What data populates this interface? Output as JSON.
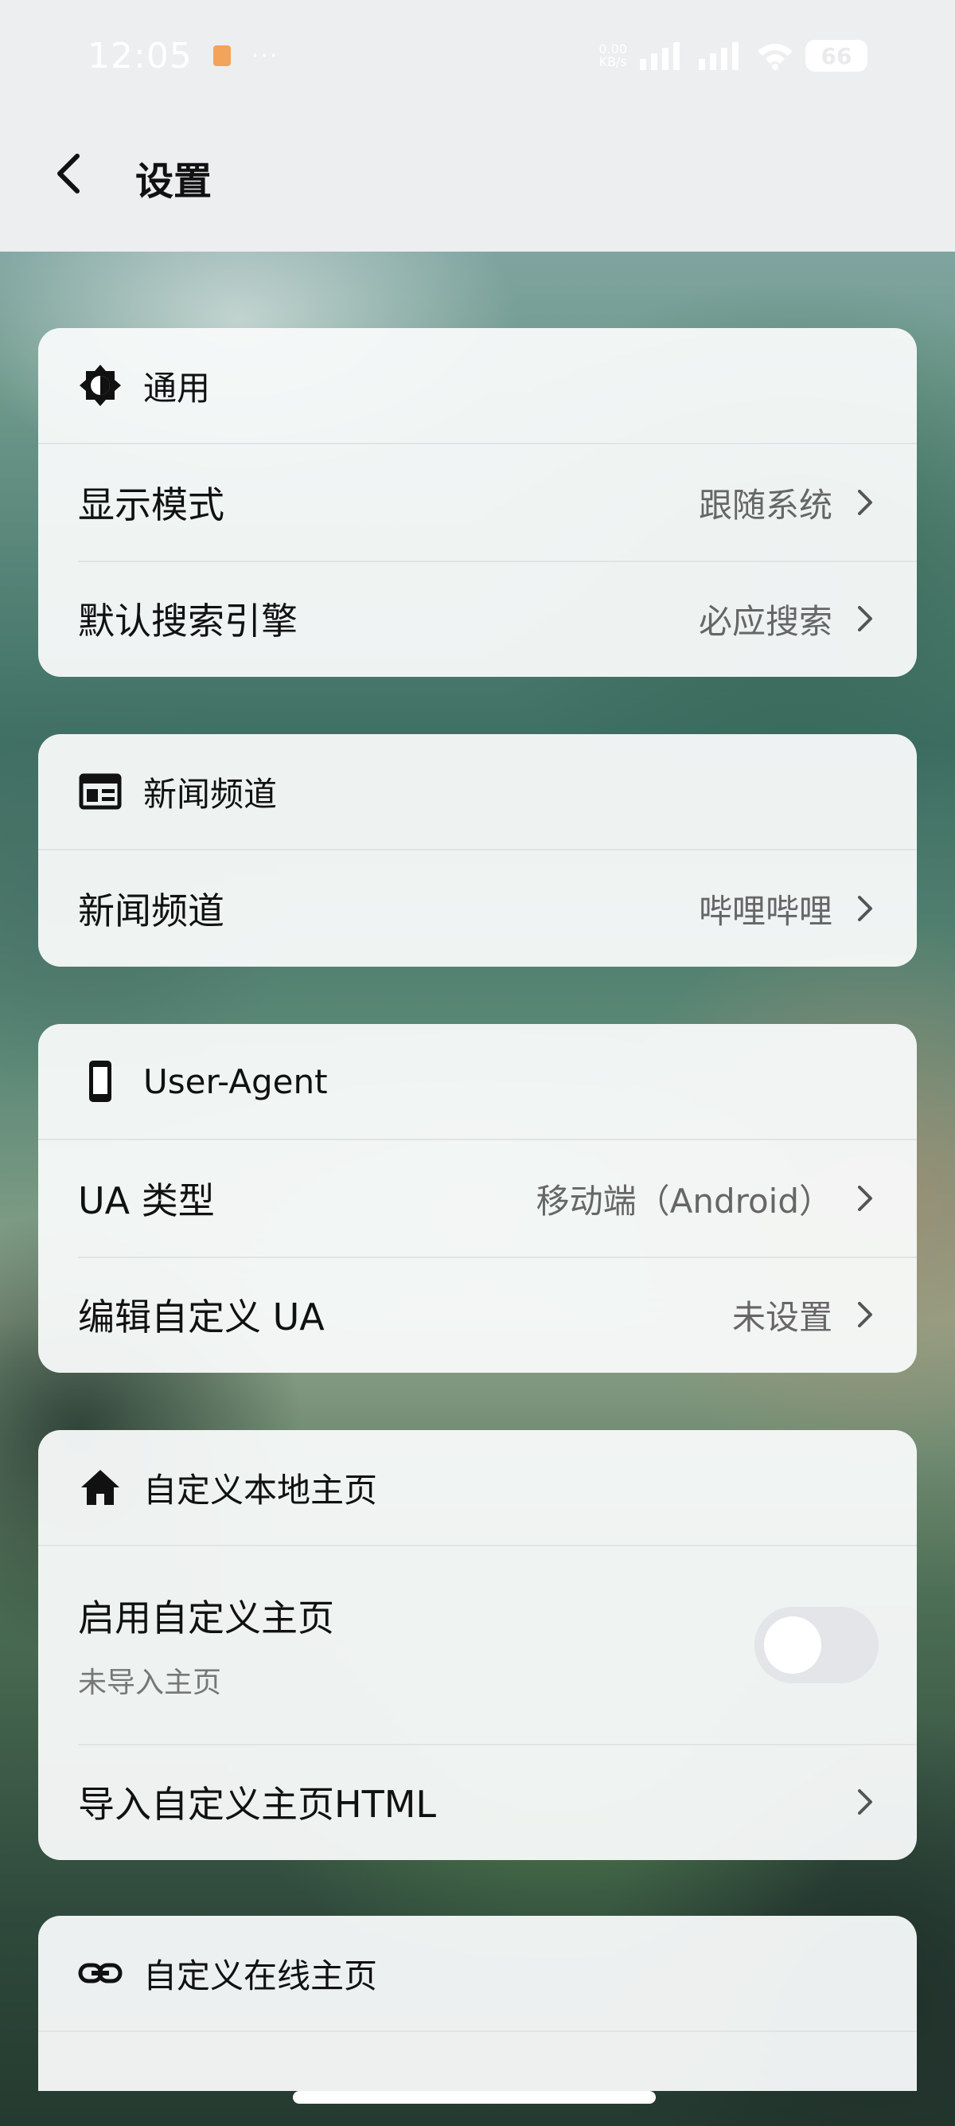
{
  "status_bar": {
    "time": "12:05",
    "dots": "···",
    "net_speed": "0.00",
    "net_unit": "KB/s",
    "battery": "66"
  },
  "header": {
    "title": "设置"
  },
  "sections": {
    "general": {
      "title": "通用",
      "rows": [
        {
          "label": "显示模式",
          "value": "跟随系统"
        },
        {
          "label": "默认搜索引擎",
          "value": "必应搜索"
        }
      ]
    },
    "news": {
      "title": "新闻频道",
      "rows": [
        {
          "label": "新闻频道",
          "value": "哔哩哔哩"
        }
      ]
    },
    "ua": {
      "title": "User-Agent",
      "rows": [
        {
          "label": "UA 类型",
          "value": "移动端（Android）"
        },
        {
          "label": "编辑自定义 UA",
          "value": "未设置"
        }
      ]
    },
    "local_home": {
      "title": "自定义本地主页",
      "enable_label": "启用自定义主页",
      "enable_sub": "未导入主页",
      "enable_on": false,
      "import_label": "导入自定义主页HTML"
    },
    "online_home": {
      "title": "自定义在线主页"
    }
  },
  "colors": {
    "accent": "#111111",
    "secondary_text": "#666666",
    "card_bg": "#f8fafa"
  }
}
